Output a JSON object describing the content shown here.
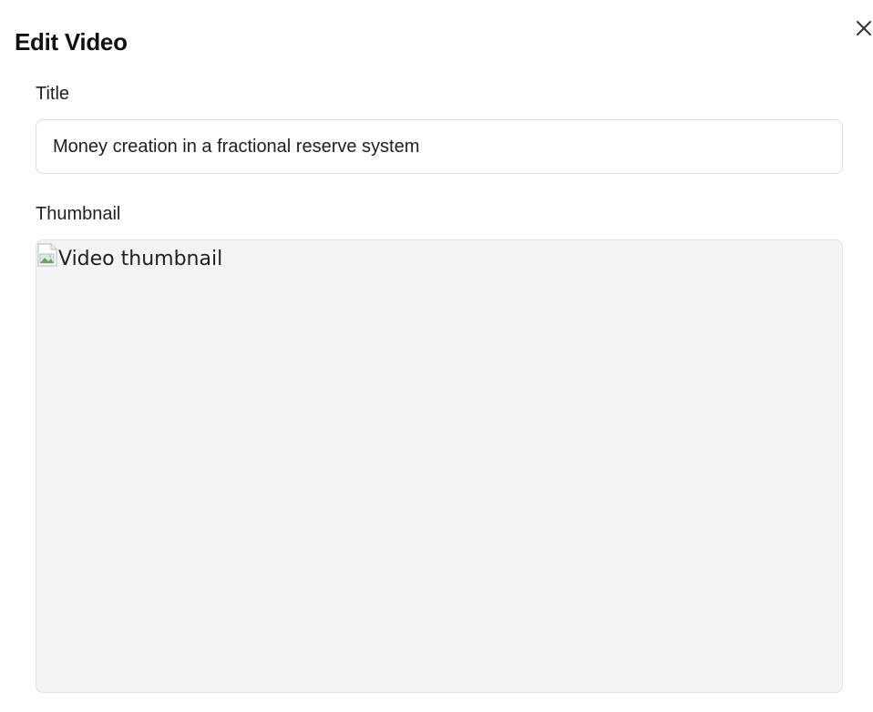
{
  "dialog": {
    "title": "Edit Video",
    "close_icon": "close-icon"
  },
  "form": {
    "title_label": "Title",
    "title_value": "Money creation in a fractional reserve system",
    "thumbnail_label": "Thumbnail",
    "thumbnail_alt": "Video thumbnail",
    "thumbnail_icon": "broken-image-icon"
  },
  "colors": {
    "thumbnail_background": "#f4f4f2",
    "input_border": "#dcdcdc",
    "text": "#1f1f1f"
  }
}
